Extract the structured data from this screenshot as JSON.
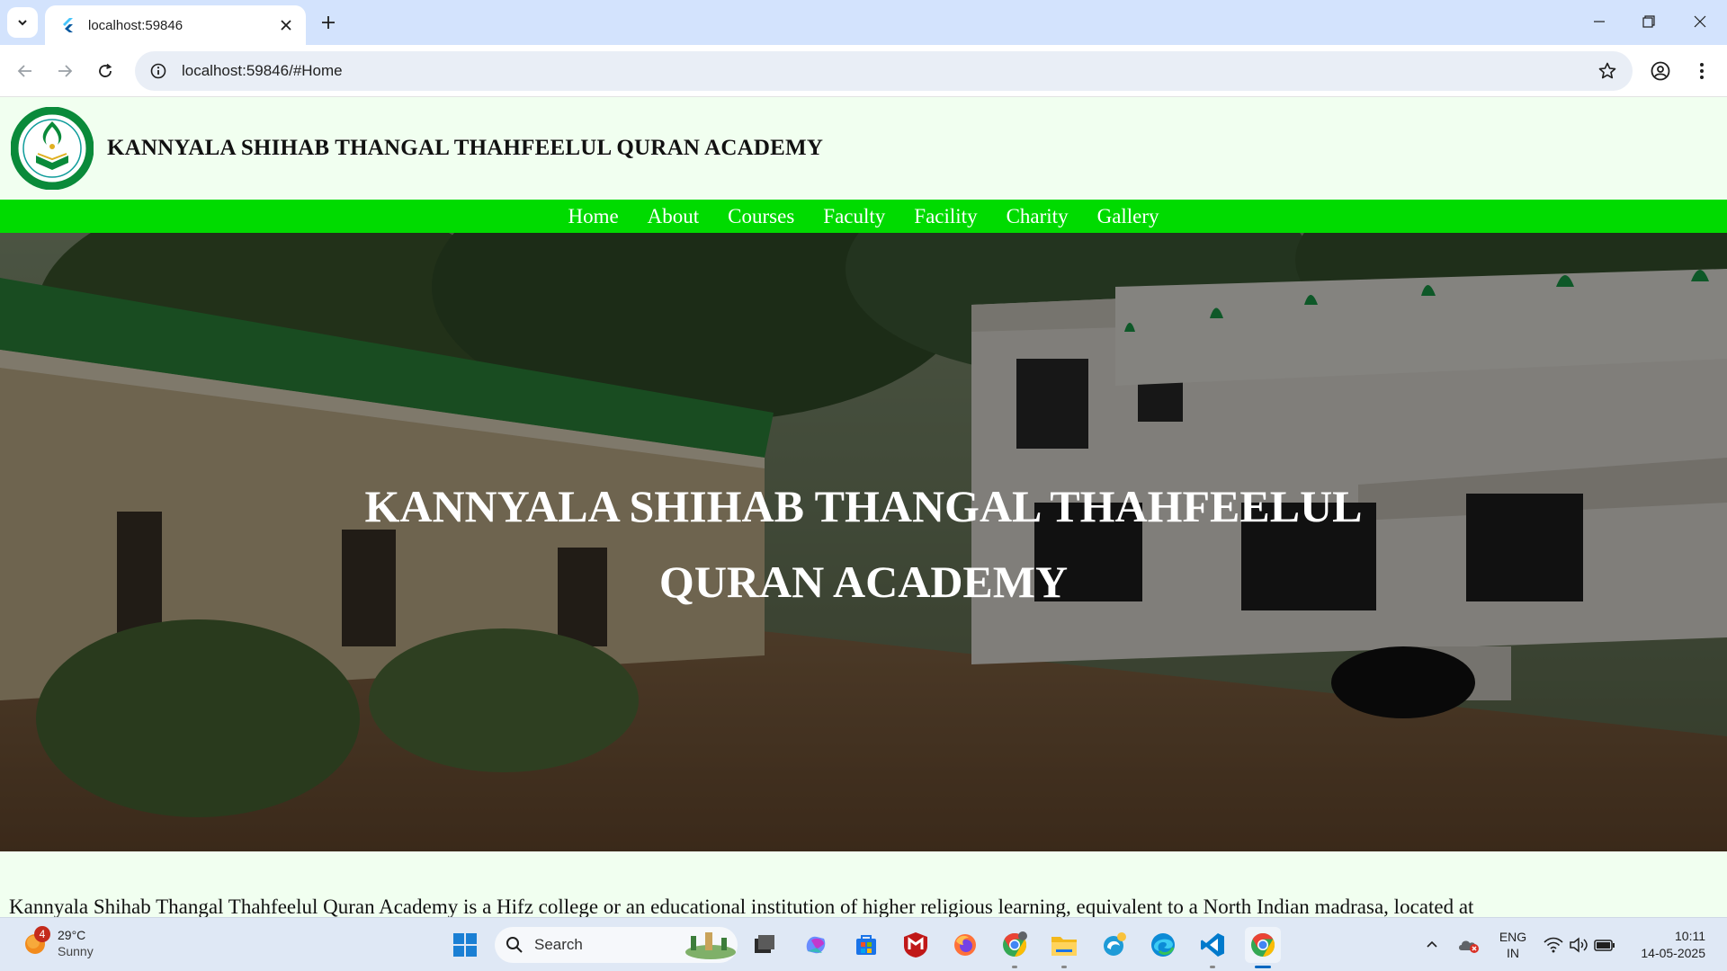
{
  "browser": {
    "tab_title": "localhost:59846",
    "url": "localhost:59846/#Home",
    "favicon": "flutter-icon"
  },
  "site": {
    "name": "KANNYALA SHIHAB THANGAL THAHFEELUL QURAN ACADEMY",
    "nav": [
      "Home",
      "About",
      "Courses",
      "Faculty",
      "Facility",
      "Charity",
      "Gallery"
    ],
    "hero_title": "KANNYALA SHIHAB THANGAL THAHFEELUL QURAN ACADEMY",
    "intro": "Kannyala Shihab Thangal Thahfeelul Quran Academy is a Hifz college or an educational institution of higher religious learning, equivalent to a North Indian madrasa, located at",
    "colors": {
      "nav_bg": "#00db00",
      "page_bg": "#f1fff0"
    }
  },
  "taskbar": {
    "weather": {
      "badge": "4",
      "temp": "29°C",
      "condition": "Sunny"
    },
    "search_label": "Search",
    "language": {
      "lang": "ENG",
      "region": "IN"
    },
    "clock": {
      "time": "10:11",
      "date": "14-05-2025"
    }
  }
}
